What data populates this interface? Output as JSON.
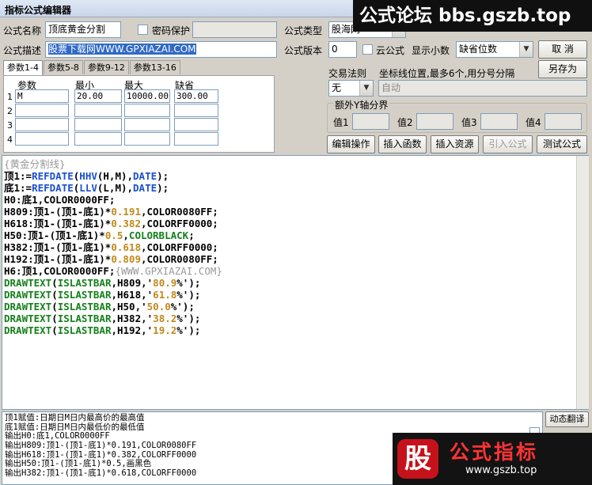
{
  "window": {
    "title": "指标公式编辑器"
  },
  "watermark": {
    "text": "公式论坛 bbs.gszb.top"
  },
  "form": {
    "name_label": "公式名称",
    "name_value": "顶底黄金分割",
    "password_label": "密码保护",
    "type_label": "公式类型",
    "type_value": "股海网",
    "desc_label": "公式描述",
    "desc_value": "股票下载网WWW.GPXIAZAI.COM",
    "version_label": "公式版本",
    "version_value": "0",
    "cloud_label": "云公式",
    "decimal_label": "显示小数",
    "decimal_value": "缺省位数"
  },
  "buttons": {
    "cancel": "取 消",
    "save_as": "另存为",
    "edit_ops": "编辑操作",
    "insert_func": "插入函数",
    "insert_res": "插入资源",
    "import_formula": "引入公式",
    "test_formula": "测试公式",
    "translate": "动态翻译"
  },
  "tabs": [
    "参数1-4",
    "参数5-8",
    "参数9-12",
    "参数13-16"
  ],
  "params": {
    "headers": [
      "参数",
      "最小",
      "最大",
      "缺省"
    ],
    "rows": [
      {
        "idx": "1",
        "name": "M",
        "min": "20.00",
        "max": "10000.00",
        "def": "300.00"
      },
      {
        "idx": "2",
        "name": "",
        "min": "",
        "max": "",
        "def": ""
      },
      {
        "idx": "3",
        "name": "",
        "min": "",
        "max": "",
        "def": ""
      },
      {
        "idx": "4",
        "name": "",
        "min": "",
        "max": "",
        "def": ""
      }
    ]
  },
  "trade": {
    "label": "交易法则",
    "value": "无",
    "coord_label": "坐标线位置,最多6个,用分号分隔",
    "coord_value": "自动"
  },
  "yaxis": {
    "title": "额外Y轴分界",
    "labels": [
      "值1",
      "值2",
      "值3",
      "值4"
    ]
  },
  "code": {
    "lines": [
      [
        {
          "c": "c",
          "t": "{黄金分割线}"
        }
      ],
      [
        {
          "c": "p",
          "t": "顶1:="
        },
        {
          "c": "k",
          "t": "REFDATE"
        },
        {
          "c": "p",
          "t": "("
        },
        {
          "c": "k",
          "t": "HHV"
        },
        {
          "c": "p",
          "t": "(H,M),"
        },
        {
          "c": "k",
          "t": "DATE"
        },
        {
          "c": "p",
          "t": ");"
        }
      ],
      [
        {
          "c": "p",
          "t": "底1:="
        },
        {
          "c": "k",
          "t": "REFDATE"
        },
        {
          "c": "p",
          "t": "("
        },
        {
          "c": "k",
          "t": "LLV"
        },
        {
          "c": "p",
          "t": "(L,M),"
        },
        {
          "c": "k",
          "t": "DATE"
        },
        {
          "c": "p",
          "t": ");"
        }
      ],
      [
        {
          "c": "p",
          "t": "H0:底1,COLOR0000FF;"
        }
      ],
      [
        {
          "c": "p",
          "t": "H809:顶1-(顶1-底1)*"
        },
        {
          "c": "n",
          "t": "0.191"
        },
        {
          "c": "p",
          "t": ",COLOR0080FF;"
        }
      ],
      [
        {
          "c": "p",
          "t": "H618:顶1-(顶1-底1)*"
        },
        {
          "c": "n",
          "t": "0.382"
        },
        {
          "c": "p",
          "t": ",COLORFF0000;"
        }
      ],
      [
        {
          "c": "p",
          "t": "H50:顶1-(顶1-底1)*"
        },
        {
          "c": "n",
          "t": "0.5"
        },
        {
          "c": "p",
          "t": ","
        },
        {
          "c": "g",
          "t": "COLORBLACK"
        },
        {
          "c": "p",
          "t": ";"
        }
      ],
      [
        {
          "c": "p",
          "t": "H382:顶1-(顶1-底1)*"
        },
        {
          "c": "n",
          "t": "0.618"
        },
        {
          "c": "p",
          "t": ",COLORFF0000;"
        }
      ],
      [
        {
          "c": "p",
          "t": "H192:顶1-(顶1-底1)*"
        },
        {
          "c": "n",
          "t": "0.809"
        },
        {
          "c": "p",
          "t": ",COLOR0080FF;"
        }
      ],
      [
        {
          "c": "p",
          "t": "H6:顶1,COLOR0000FF;"
        },
        {
          "c": "c",
          "t": "{WWW.GPXIAZAI.COM}"
        }
      ],
      [
        {
          "c": "g",
          "t": "DRAWTEXT"
        },
        {
          "c": "p",
          "t": "("
        },
        {
          "c": "g",
          "t": "ISLASTBAR"
        },
        {
          "c": "p",
          "t": ",H809,'"
        },
        {
          "c": "n",
          "t": "80.9"
        },
        {
          "c": "p",
          "t": "%');"
        }
      ],
      [
        {
          "c": "g",
          "t": "DRAWTEXT"
        },
        {
          "c": "p",
          "t": "("
        },
        {
          "c": "g",
          "t": "ISLASTBAR"
        },
        {
          "c": "p",
          "t": ",H618,'"
        },
        {
          "c": "n",
          "t": "61.8"
        },
        {
          "c": "p",
          "t": "%');"
        }
      ],
      [
        {
          "c": "g",
          "t": "DRAWTEXT"
        },
        {
          "c": "p",
          "t": "("
        },
        {
          "c": "g",
          "t": "ISLASTBAR"
        },
        {
          "c": "p",
          "t": ",H50,'"
        },
        {
          "c": "n",
          "t": "50.0"
        },
        {
          "c": "p",
          "t": "%');"
        }
      ],
      [
        {
          "c": "g",
          "t": "DRAWTEXT"
        },
        {
          "c": "p",
          "t": "("
        },
        {
          "c": "g",
          "t": "ISLASTBAR"
        },
        {
          "c": "p",
          "t": ",H382,'"
        },
        {
          "c": "n",
          "t": "38.2"
        },
        {
          "c": "p",
          "t": "%');"
        }
      ],
      [
        {
          "c": "g",
          "t": "DRAWTEXT"
        },
        {
          "c": "p",
          "t": "("
        },
        {
          "c": "g",
          "t": "ISLASTBAR"
        },
        {
          "c": "p",
          "t": ",H192,'"
        },
        {
          "c": "n",
          "t": "19.2"
        },
        {
          "c": "p",
          "t": "%');"
        }
      ]
    ]
  },
  "output": {
    "lines": [
      "顶1赋值:日期日M日内最高价的最高值",
      "底1赋值:日期日M日内最低价的最低值",
      "输出H0:底1,COLOR0000FF",
      "输出H809:顶1-(顶1-底1)*0.191,COLOR0080FF",
      "输出H618:顶1-(顶1-底1)*0.382,COLORFF0000",
      "输出H50:顶1-(顶1-底1)*0.5,画黑色",
      "输出H382:顶1-(顶1-底1)*0.618,COLORFF0000"
    ]
  },
  "logo": {
    "mark": "股",
    "title": "公式指标",
    "url": "www.gszb.top"
  },
  "colors": {
    "keyword": "#1a4fd0",
    "function": "#14801a",
    "number": "#c08a1c",
    "comment": "#999999"
  }
}
